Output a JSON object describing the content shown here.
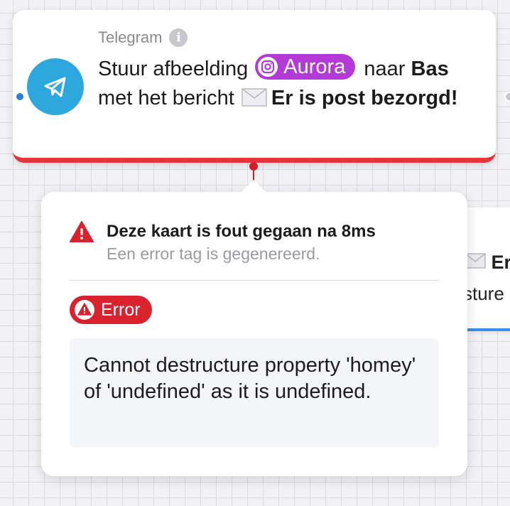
{
  "background_card": {
    "line1_text": "Er",
    "line2_text": "sture"
  },
  "node": {
    "app_name": "Telegram",
    "action_text": "Stuur afbeelding",
    "source_app": "Aurora",
    "connector_word": "naar",
    "recipient": "Bas",
    "message_intro": "met het bericht",
    "message_text": "Er is post bezorgd!",
    "accent_color": "#2ea6de",
    "error_color": "#e8323a"
  },
  "error_panel": {
    "title": "Deze kaart is fout gegaan na 8ms",
    "subtitle": "Een error tag is gegenereerd.",
    "badge_label": "Error",
    "message": "Cannot destructure property 'homey' of 'undefined' as it is undefined."
  },
  "icons": {
    "node_logo": "telegram-paper-plane-icon",
    "info": "info-icon",
    "source": "instagram-camera-icon",
    "envelope": "envelope-icon",
    "warning": "warning-triangle-icon"
  }
}
